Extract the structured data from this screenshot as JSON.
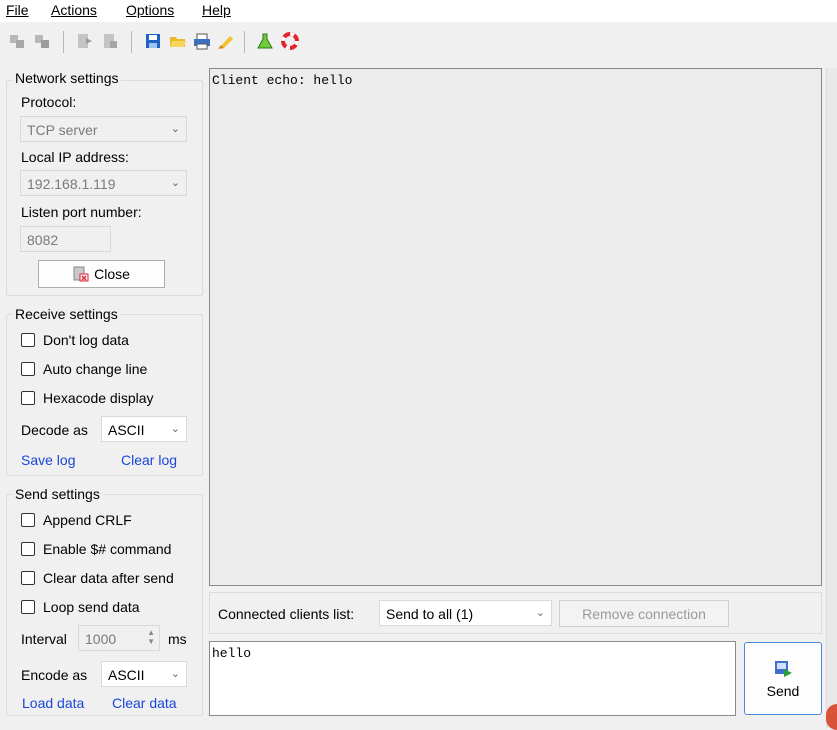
{
  "menu": {
    "file": "File",
    "actions": "Actions",
    "options": "Options",
    "help": "Help"
  },
  "toolbar_icons": [
    "connect-icon",
    "disconnect-icon",
    "send-file-icon",
    "stop-icon",
    "save-icon",
    "open-icon",
    "print-icon",
    "clear-icon",
    "test-icon",
    "help-icon"
  ],
  "network": {
    "title": "Network settings",
    "protocol_label": "Protocol:",
    "protocol_value": "TCP server",
    "ip_label": "Local IP address:",
    "ip_value": "192.168.1.119",
    "port_label": "Listen port number:",
    "port_value": "8082",
    "close_label": "Close"
  },
  "receive": {
    "title": "Receive settings",
    "dont_log": "Don't log data",
    "auto_change_line": "Auto change line",
    "hexcode": "Hexacode display",
    "decode_label": "Decode as",
    "decode_value": "ASCII",
    "save_log": "Save log",
    "clear_log": "Clear log"
  },
  "send": {
    "title": "Send settings",
    "append_crlf": "Append CRLF",
    "enable_cmd": "Enable $# command",
    "clear_after": "Clear data after send",
    "loop_send": "Loop send data",
    "interval_label": "Interval",
    "interval_value": "1000",
    "ms": "ms",
    "encode_label": "Encode as",
    "encode_value": "ASCII",
    "load_data": "Load data",
    "clear_data": "Clear data"
  },
  "receive_area": {
    "text": "Client echo: hello"
  },
  "clients": {
    "label": "Connected clients list:",
    "value": "Send to all (1)",
    "remove": "Remove connection"
  },
  "send_area": {
    "text": "hello",
    "send_label": "Send"
  }
}
